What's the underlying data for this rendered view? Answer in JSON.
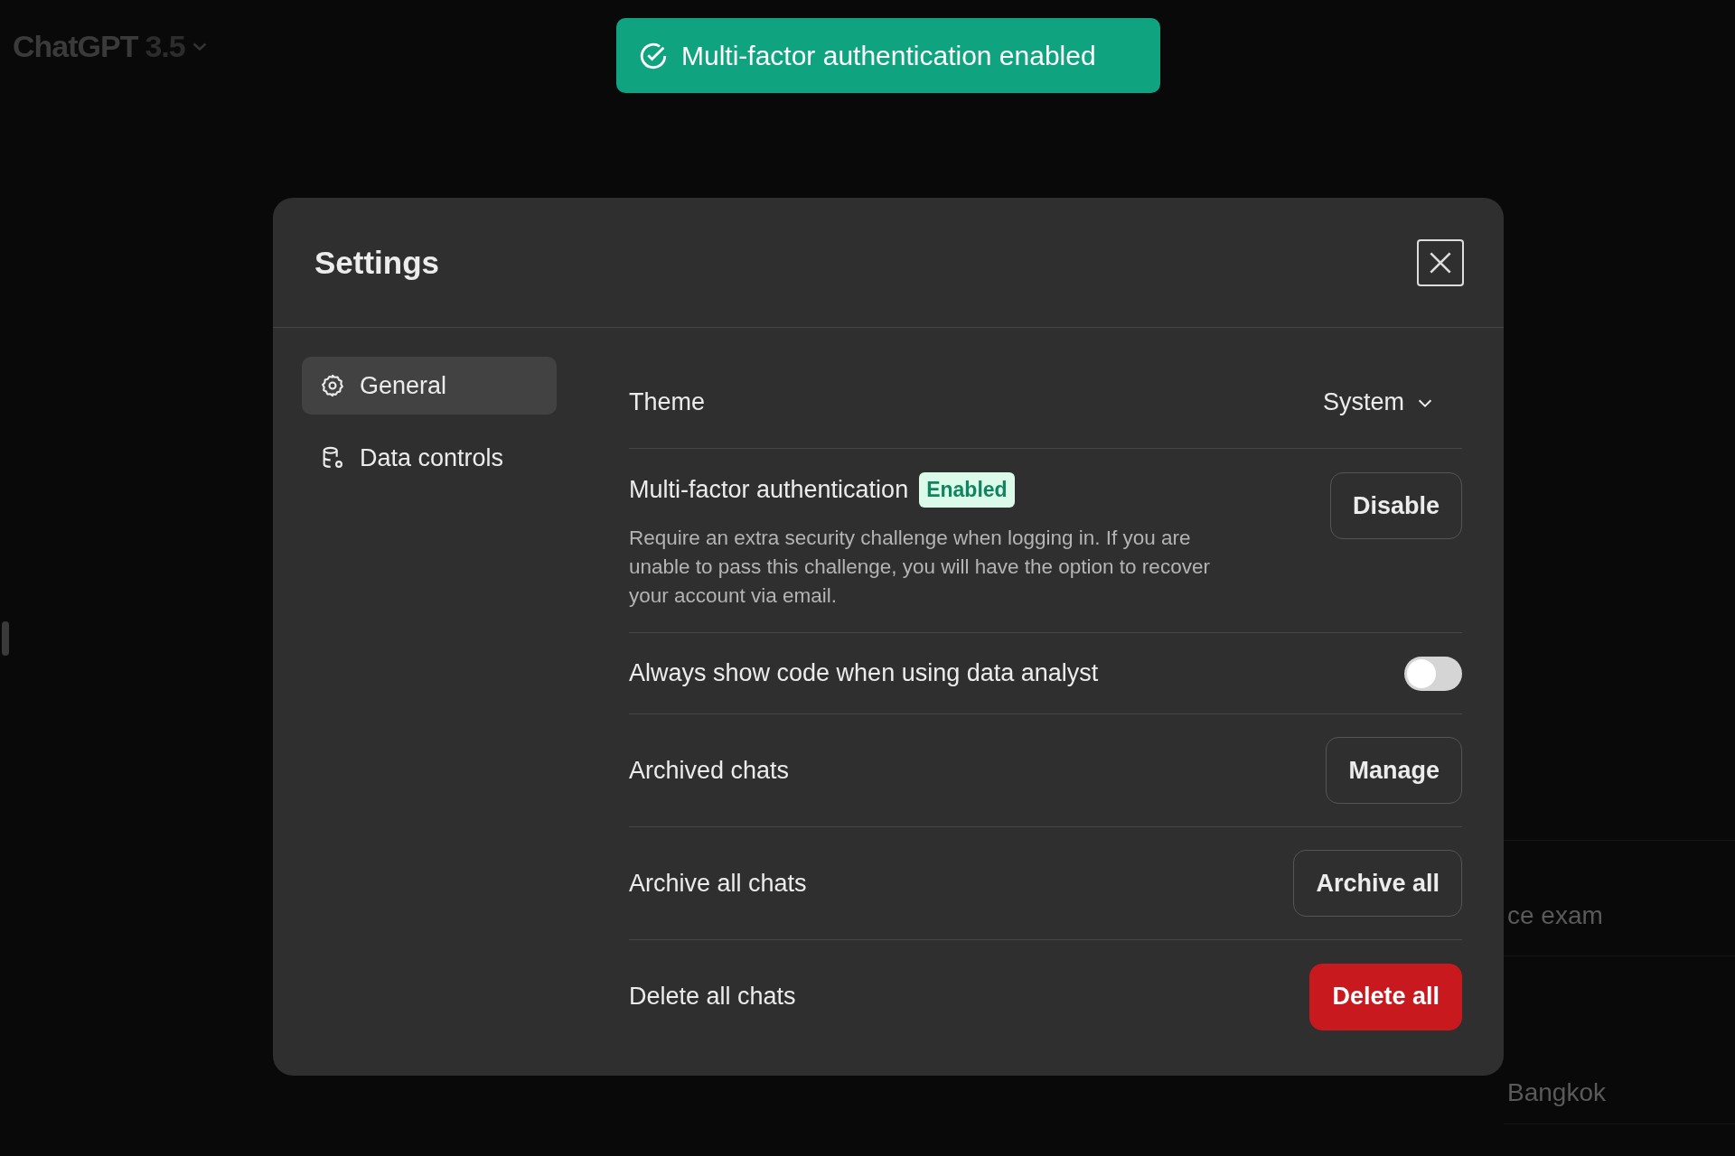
{
  "app_header": {
    "title": "ChatGPT",
    "version": "3.5"
  },
  "background_items": [
    {
      "text": "ce exam"
    },
    {
      "text": "Bangkok"
    }
  ],
  "toast": {
    "message": "Multi-factor authentication enabled"
  },
  "settings": {
    "title": "Settings",
    "sidebar": [
      {
        "label": "General",
        "kind": "gear",
        "selected": true
      },
      {
        "label": "Data controls",
        "kind": "database",
        "selected": false
      }
    ],
    "rows": [
      {
        "kind": "select",
        "label": "Theme",
        "value": "System"
      },
      {
        "kind": "button",
        "label": "Multi-factor authentication",
        "badge": "Enabled",
        "description": "Require an extra security challenge when logging in. If you are unable to pass this challenge, you will have the option to recover your account via email.",
        "button": "Disable"
      },
      {
        "kind": "toggle",
        "label": "Always show code when using data analyst",
        "on": false
      },
      {
        "kind": "button",
        "label": "Archived chats",
        "button": "Manage"
      },
      {
        "kind": "button",
        "label": "Archive all chats",
        "button": "Archive all"
      },
      {
        "kind": "danger",
        "label": "Delete all chats",
        "button": "Delete all"
      }
    ]
  }
}
